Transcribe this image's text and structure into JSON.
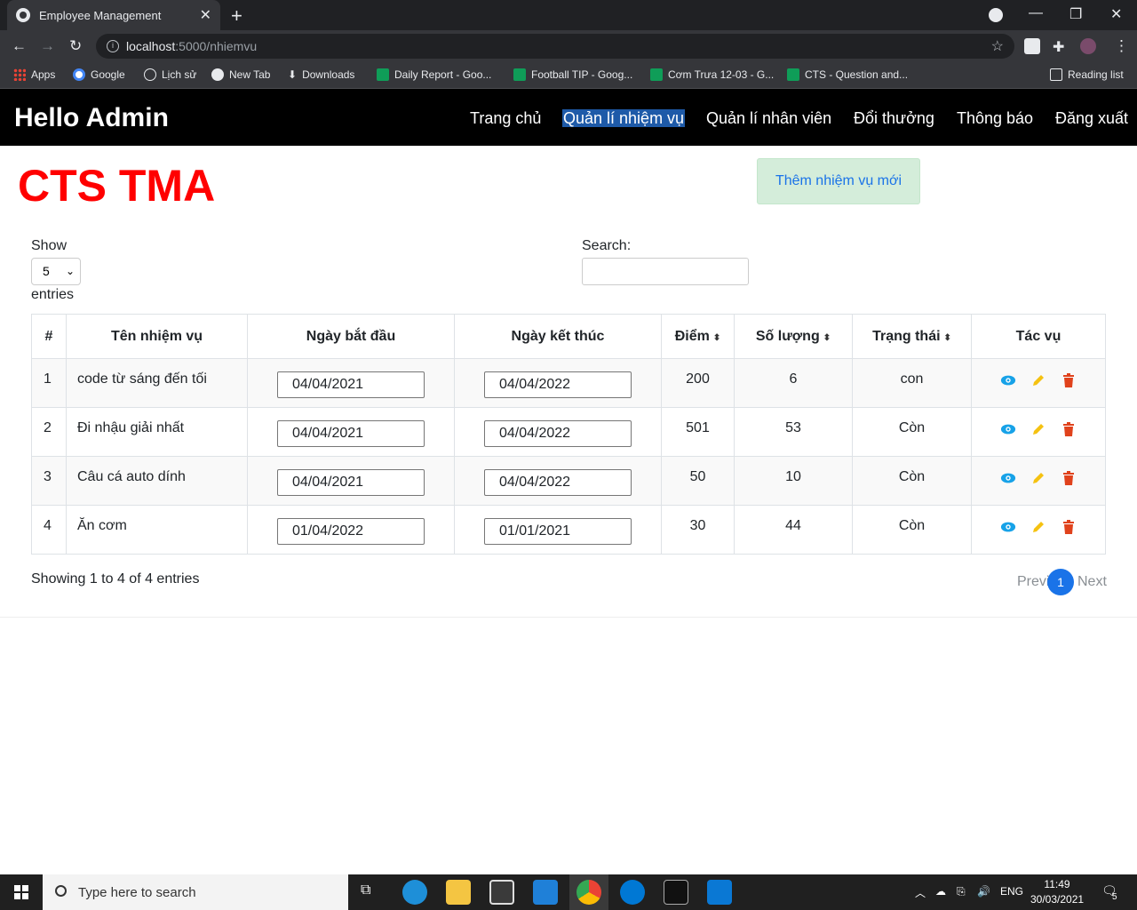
{
  "browser": {
    "tab_title": "Employee Management",
    "tab_close": "✕",
    "new_tab": "+",
    "url_host": "localhost",
    "url_path": ":5000/nhiemvu",
    "bookmarks": [
      "Apps",
      "Google",
      "Lịch sử",
      "New Tab",
      "Downloads",
      "Daily Report - Goo...",
      "Football TIP - Goog...",
      "Cơm Trưa 12-03 - G...",
      "CTS - Question and..."
    ],
    "reading_list": "Reading list"
  },
  "nav": {
    "brand": "Hello Admin",
    "links": [
      "Trang chủ",
      "Quản lí nhiệm vụ",
      "Quản lí nhân viên",
      "Đổi thưởng",
      "Thông báo",
      "Đăng xuất"
    ]
  },
  "page": {
    "heading": "CTS TMA",
    "add_button": "Thêm nhiệm vụ mới",
    "show_label": "Show",
    "show_value": "5",
    "entries_label": "entries",
    "search_label": "Search:",
    "info": "Showing 1 to 4 of 4 entries",
    "prev": "Previ",
    "page_num": "1",
    "next": "Next"
  },
  "table": {
    "headers": [
      "#",
      "Tên nhiệm vụ",
      "Ngày bắt đầu",
      "Ngày kết thúc",
      "Điểm",
      "Số lượng",
      "Trạng thái",
      "Tác vụ"
    ],
    "rows": [
      {
        "num": "1",
        "name": "code từ sáng đến tối",
        "start": "04/04/2021",
        "end": "04/04/2022",
        "points": "200",
        "qty": "6",
        "status": "con"
      },
      {
        "num": "2",
        "name": "Đi nhậu giải nhất",
        "start": "04/04/2021",
        "end": "04/04/2022",
        "points": "501",
        "qty": "53",
        "status": "Còn"
      },
      {
        "num": "3",
        "name": "Câu cá auto dính",
        "start": "04/04/2021",
        "end": "04/04/2022",
        "points": "50",
        "qty": "10",
        "status": "Còn"
      },
      {
        "num": "4",
        "name": "Ăn cơm",
        "start": "01/04/2022",
        "end": "01/01/2021",
        "points": "30",
        "qty": "44",
        "status": "Còn"
      }
    ]
  },
  "taskbar": {
    "search_placeholder": "Type here to search",
    "lang": "ENG",
    "time": "11:49",
    "date": "30/03/2021",
    "notif_count": "5"
  },
  "colors": {
    "brand_red": "#ff0000",
    "view_icon": "#17a2e8",
    "edit_icon": "#f5c211",
    "delete_icon": "#e0421c"
  }
}
